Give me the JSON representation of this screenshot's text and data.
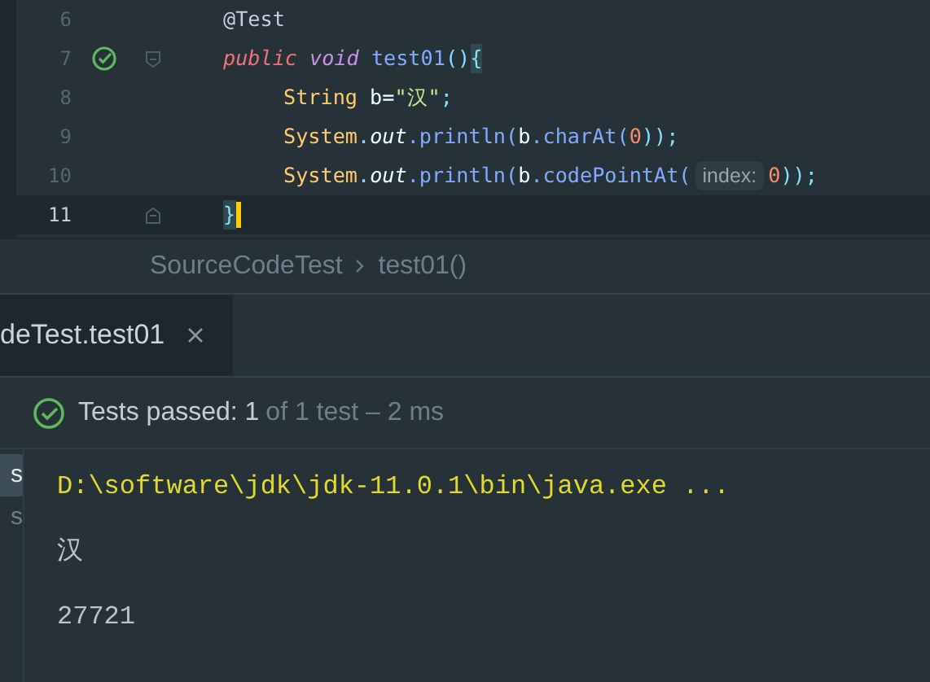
{
  "editor": {
    "lines": [
      {
        "number": "6",
        "current": false,
        "indented": false,
        "run_icon": false,
        "fold_open": false,
        "fold_close": false,
        "tokens": [
          {
            "text": "@Test",
            "kind": "annotation",
            "spaced": false
          }
        ]
      },
      {
        "number": "7",
        "current": false,
        "indented": false,
        "run_icon": true,
        "fold_open": true,
        "fold_close": false,
        "tokens": [
          {
            "text": "public",
            "kind": "keyword",
            "spaced": false
          },
          {
            "text": "void",
            "kind": "type",
            "spaced": true
          },
          {
            "text": "test01",
            "kind": "method",
            "spaced": true
          },
          {
            "text": "()",
            "kind": "punct",
            "spaced": false
          },
          {
            "text": "{",
            "kind": "brace",
            "spaced": false
          }
        ]
      },
      {
        "number": "8",
        "current": false,
        "indented": true,
        "run_icon": false,
        "fold_open": false,
        "fold_close": false,
        "tokens": [
          {
            "text": "String",
            "kind": "class",
            "spaced": false
          },
          {
            "text": "b=",
            "kind": "plain",
            "spaced": true
          },
          {
            "text": "\"汉\"",
            "kind": "string",
            "spaced": false
          },
          {
            "text": ";",
            "kind": "punct",
            "spaced": false
          }
        ]
      },
      {
        "number": "9",
        "current": false,
        "indented": true,
        "run_icon": false,
        "fold_open": false,
        "fold_close": false,
        "tokens": [
          {
            "text": "System",
            "kind": "class",
            "spaced": false
          },
          {
            "text": ".",
            "kind": "punct",
            "spaced": false
          },
          {
            "text": "out",
            "kind": "field",
            "spaced": false
          },
          {
            "text": ".println(",
            "kind": "method",
            "spaced": false
          },
          {
            "text": "b",
            "kind": "plain",
            "spaced": false
          },
          {
            "text": ".charAt(",
            "kind": "method",
            "spaced": false
          },
          {
            "text": "0",
            "kind": "number",
            "spaced": false
          },
          {
            "text": "));",
            "kind": "punct",
            "spaced": false
          }
        ]
      },
      {
        "number": "10",
        "current": false,
        "indented": true,
        "run_icon": false,
        "fold_open": false,
        "fold_close": false,
        "tokens": [
          {
            "text": "System",
            "kind": "class",
            "spaced": false
          },
          {
            "text": ".",
            "kind": "punct",
            "spaced": false
          },
          {
            "text": "out",
            "kind": "field",
            "spaced": false
          },
          {
            "text": ".println(",
            "kind": "method",
            "spaced": false
          },
          {
            "text": "b",
            "kind": "plain",
            "spaced": false
          },
          {
            "text": ".codePointAt(",
            "kind": "method",
            "spaced": false
          },
          {
            "text": "index:",
            "kind": "hint",
            "spaced": false
          },
          {
            "text": "0",
            "kind": "number",
            "spaced": false
          },
          {
            "text": "));",
            "kind": "punct",
            "spaced": false
          }
        ]
      },
      {
        "number": "11",
        "current": true,
        "indented": false,
        "run_icon": false,
        "fold_open": false,
        "fold_close": true,
        "tokens": [
          {
            "text": "}",
            "kind": "brace",
            "spaced": false
          }
        ]
      }
    ]
  },
  "breadcrumb": [
    "SourceCodeTest",
    "test01()"
  ],
  "run_tabs": [
    {
      "label": "deTest.test01",
      "selected": true
    }
  ],
  "summary": {
    "passed": true,
    "main": "Tests passed: 1",
    "detail": "of 1 test – 2 ms"
  },
  "tree_items": [
    {
      "label": "s",
      "selected": true
    },
    {
      "label": "s",
      "selected": false
    }
  ],
  "console": [
    {
      "text": "D:\\software\\jdk\\jdk-11.0.1\\bin\\java.exe ...",
      "kind": "command"
    },
    {
      "text": "汉",
      "kind": "output"
    },
    {
      "text": "27721",
      "kind": "output"
    }
  ]
}
